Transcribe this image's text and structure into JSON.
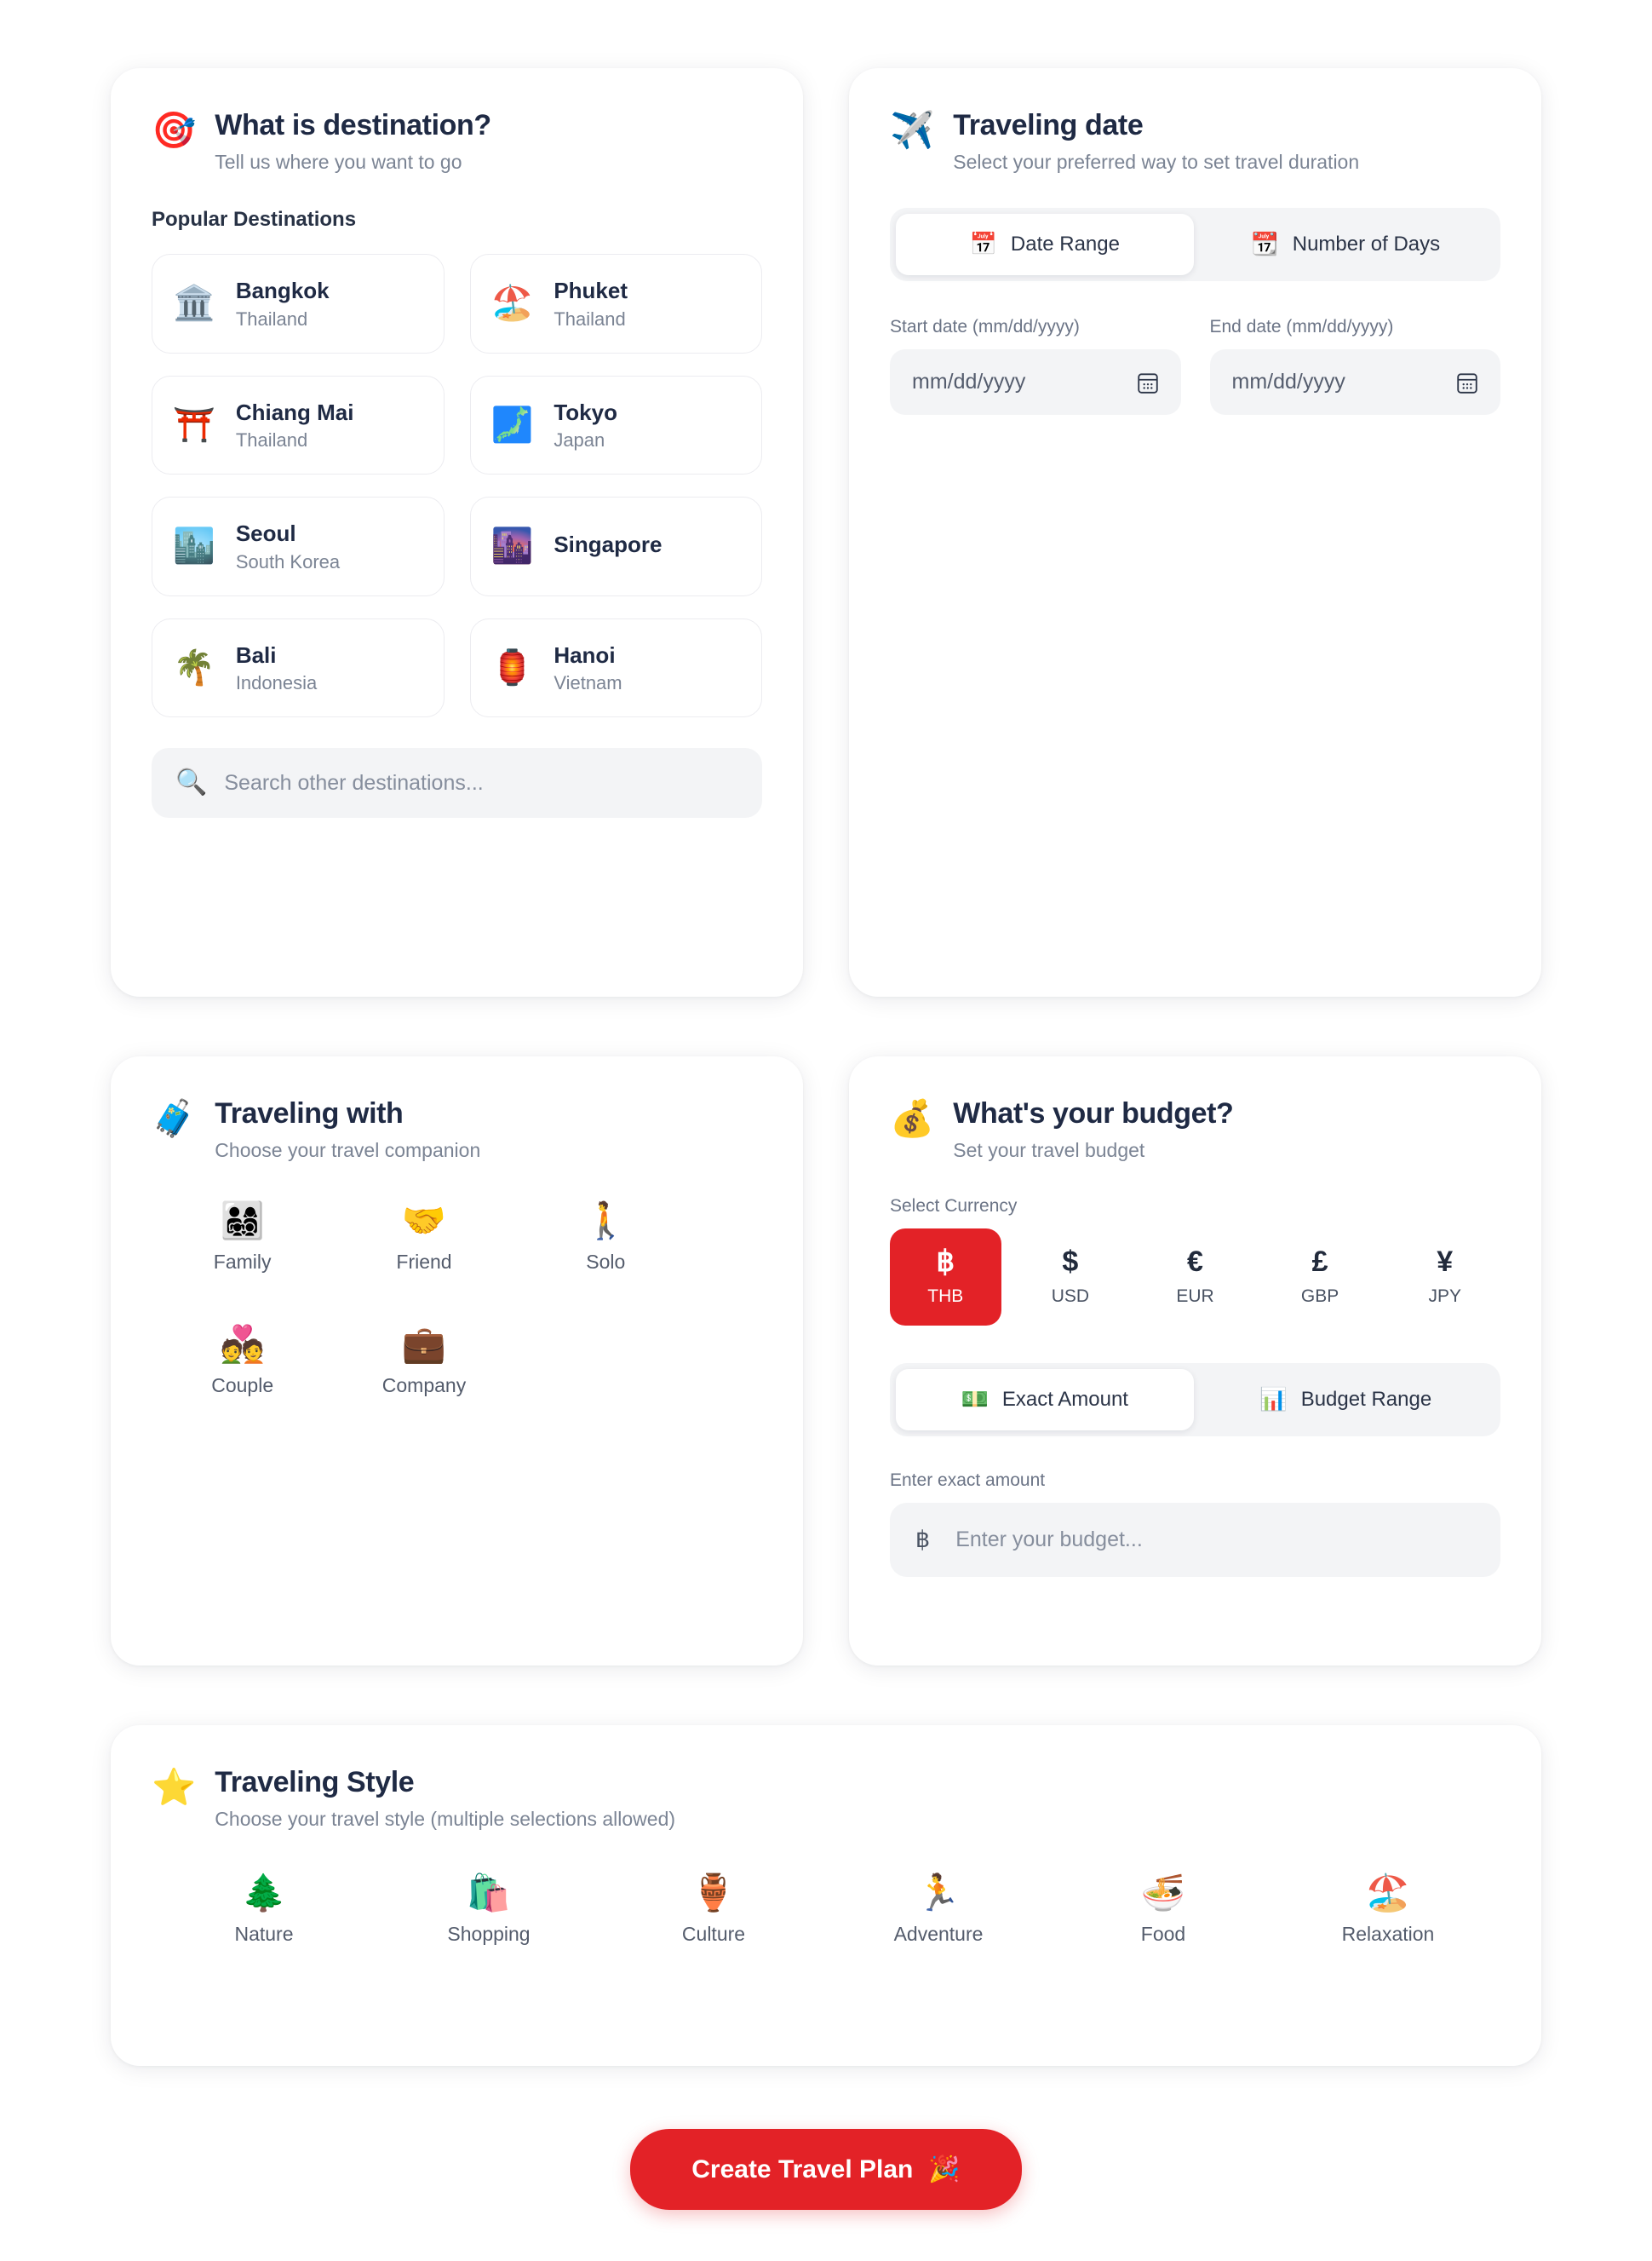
{
  "accent_color": "#E32227",
  "destination": {
    "icon": "dart-board-emoji",
    "emoji": "🎯",
    "title": "What is destination?",
    "subtitle": "Tell us where you want to go",
    "popular_label": "Popular Destinations",
    "places": [
      {
        "emoji": "🏛️",
        "icon": "classical-building-emoji",
        "city": "Bangkok",
        "country": "Thailand"
      },
      {
        "emoji": "🏖️",
        "icon": "beach-umbrella-emoji",
        "city": "Phuket",
        "country": "Thailand"
      },
      {
        "emoji": "⛩️",
        "icon": "shinto-shrine-emoji",
        "city": "Chiang Mai",
        "country": "Thailand"
      },
      {
        "emoji": "🗾",
        "icon": "map-of-japan-emoji",
        "city": "Tokyo",
        "country": "Japan"
      },
      {
        "emoji": "🏙️",
        "icon": "cityscape-emoji",
        "city": "Seoul",
        "country": "South Korea"
      },
      {
        "emoji": "🌆",
        "icon": "city-at-dusk-emoji",
        "city": "Singapore",
        "country": ""
      },
      {
        "emoji": "🌴",
        "icon": "palm-tree-emoji",
        "city": "Bali",
        "country": "Indonesia"
      },
      {
        "emoji": "🏮",
        "icon": "red-lantern-emoji",
        "city": "Hanoi",
        "country": "Vietnam"
      }
    ],
    "search_placeholder": "Search other destinations...",
    "search_icon": "magnifying-glass-emoji",
    "search_emoji": "🔍"
  },
  "dates": {
    "icon": "airplane-emoji",
    "emoji": "✈️",
    "title": "Traveling date",
    "subtitle": "Select your preferred way to set travel duration",
    "tabs": [
      {
        "label": "Date Range",
        "emoji": "📅",
        "icon": "calendar-emoji",
        "active": true
      },
      {
        "label": "Number of Days",
        "emoji": "📆",
        "icon": "tear-off-calendar-emoji",
        "active": false
      }
    ],
    "start_label": "Start date (mm/dd/yyyy)",
    "start_placeholder": "mm/dd/yyyy",
    "end_label": "End date (mm/dd/yyyy)",
    "end_placeholder": "mm/dd/yyyy"
  },
  "companion": {
    "icon": "luggage-emoji",
    "emoji": "🧳",
    "title": "Traveling with",
    "subtitle": "Choose your travel companion",
    "options": [
      {
        "emoji": "👨‍👩‍👧‍👦",
        "icon": "family-emoji",
        "label": "Family"
      },
      {
        "emoji": "🤝",
        "icon": "handshake-emoji",
        "label": "Friend"
      },
      {
        "emoji": "🚶",
        "icon": "person-walking-emoji",
        "label": "Solo"
      },
      {
        "emoji": "💑",
        "icon": "couple-with-heart-emoji",
        "label": "Couple"
      },
      {
        "emoji": "💼",
        "icon": "briefcase-emoji",
        "label": "Company"
      }
    ]
  },
  "budget": {
    "icon": "money-bag-emoji",
    "emoji": "💰",
    "title": "What's your budget?",
    "subtitle": "Set your travel budget",
    "currency_label": "Select Currency",
    "currencies": [
      {
        "symbol": "฿",
        "code": "THB",
        "active": true
      },
      {
        "symbol": "$",
        "code": "USD",
        "active": false
      },
      {
        "symbol": "€",
        "code": "EUR",
        "active": false
      },
      {
        "symbol": "£",
        "code": "GBP",
        "active": false
      },
      {
        "symbol": "¥",
        "code": "JPY",
        "active": false
      }
    ],
    "tabs": [
      {
        "label": "Exact Amount",
        "emoji": "💵",
        "icon": "dollar-banknote-emoji",
        "active": true
      },
      {
        "label": "Budget Range",
        "emoji": "📊",
        "icon": "bar-chart-emoji",
        "active": false
      }
    ],
    "amount_label": "Enter exact amount",
    "amount_symbol": "฿",
    "amount_placeholder": "Enter your budget..."
  },
  "style": {
    "icon": "star-emoji",
    "emoji": "⭐",
    "title": "Traveling Style",
    "subtitle": "Choose your travel style (multiple selections allowed)",
    "options": [
      {
        "emoji": "🌲",
        "icon": "evergreen-tree-emoji",
        "label": "Nature"
      },
      {
        "emoji": "🛍️",
        "icon": "shopping-bags-emoji",
        "label": "Shopping"
      },
      {
        "emoji": "🏺",
        "icon": "amphora-emoji",
        "label": "Culture"
      },
      {
        "emoji": "🏃",
        "icon": "person-running-emoji",
        "label": "Adventure"
      },
      {
        "emoji": "🍜",
        "icon": "steaming-bowl-emoji",
        "label": "Food"
      },
      {
        "emoji": "🏖️",
        "icon": "beach-umbrella-emoji",
        "label": "Relaxation"
      }
    ]
  },
  "cta": {
    "label": "Create Travel Plan",
    "emoji": "🎉",
    "icon": "party-popper-emoji"
  }
}
